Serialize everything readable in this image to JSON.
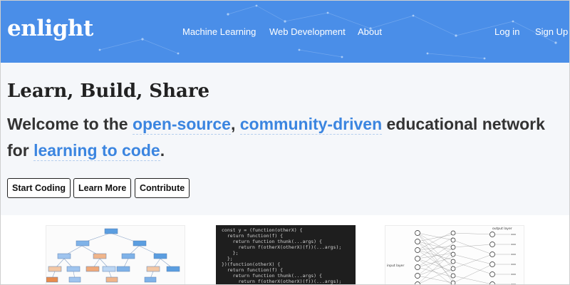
{
  "header": {
    "logo": "enlight",
    "nav": {
      "machine_learning": "Machine Learning",
      "web_development": "Web Development",
      "about": "About",
      "login": "Log in",
      "signup": "Sign Up"
    },
    "brand_color": "#4a8ee8"
  },
  "hero": {
    "title": "Learn, Build, Share",
    "subtitle": {
      "part1": "Welcome to the ",
      "link1": "open-source",
      "comma": ",",
      "link2": "community-driven",
      "part2": " educational network for ",
      "link3": "learning to code",
      "period": "."
    },
    "buttons": {
      "start": "Start Coding",
      "learn": "Learn More",
      "contribute": "Contribute"
    },
    "accent_color": "#3b85e0"
  },
  "cards": {
    "code_lines": [
      "const y = (function(otherX) {",
      "  return function(f) {",
      "    return function thunk(...args) {",
      "      return f(otherX(otherX)(f))(...args);",
      "    };",
      "  };",
      "})(function(otherX) {",
      "  return function(f) {",
      "    return function thunk(...args) {",
      "      return f(otherX(otherX)(f))(...args);"
    ],
    "nn_labels": {
      "input": "input layer",
      "output": "output layer"
    }
  }
}
